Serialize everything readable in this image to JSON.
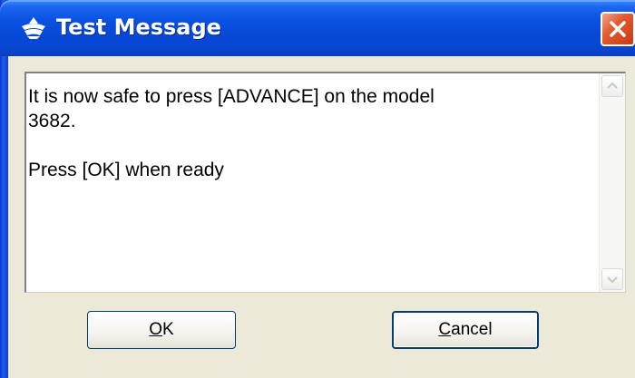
{
  "window": {
    "title": "Test Message",
    "icon": "app-icon"
  },
  "message": {
    "line1": "It is now safe to press [ADVANCE] on the model",
    "line2": "3682.",
    "line3": "Press [OK] when ready"
  },
  "buttons": {
    "ok": {
      "accel": "O",
      "rest": "K"
    },
    "cancel": {
      "accel": "C",
      "rest": "ancel"
    }
  },
  "colors": {
    "titlebar": "#0a52e2",
    "close": "#e25a30",
    "dialog_bg": "#ece9d8"
  }
}
